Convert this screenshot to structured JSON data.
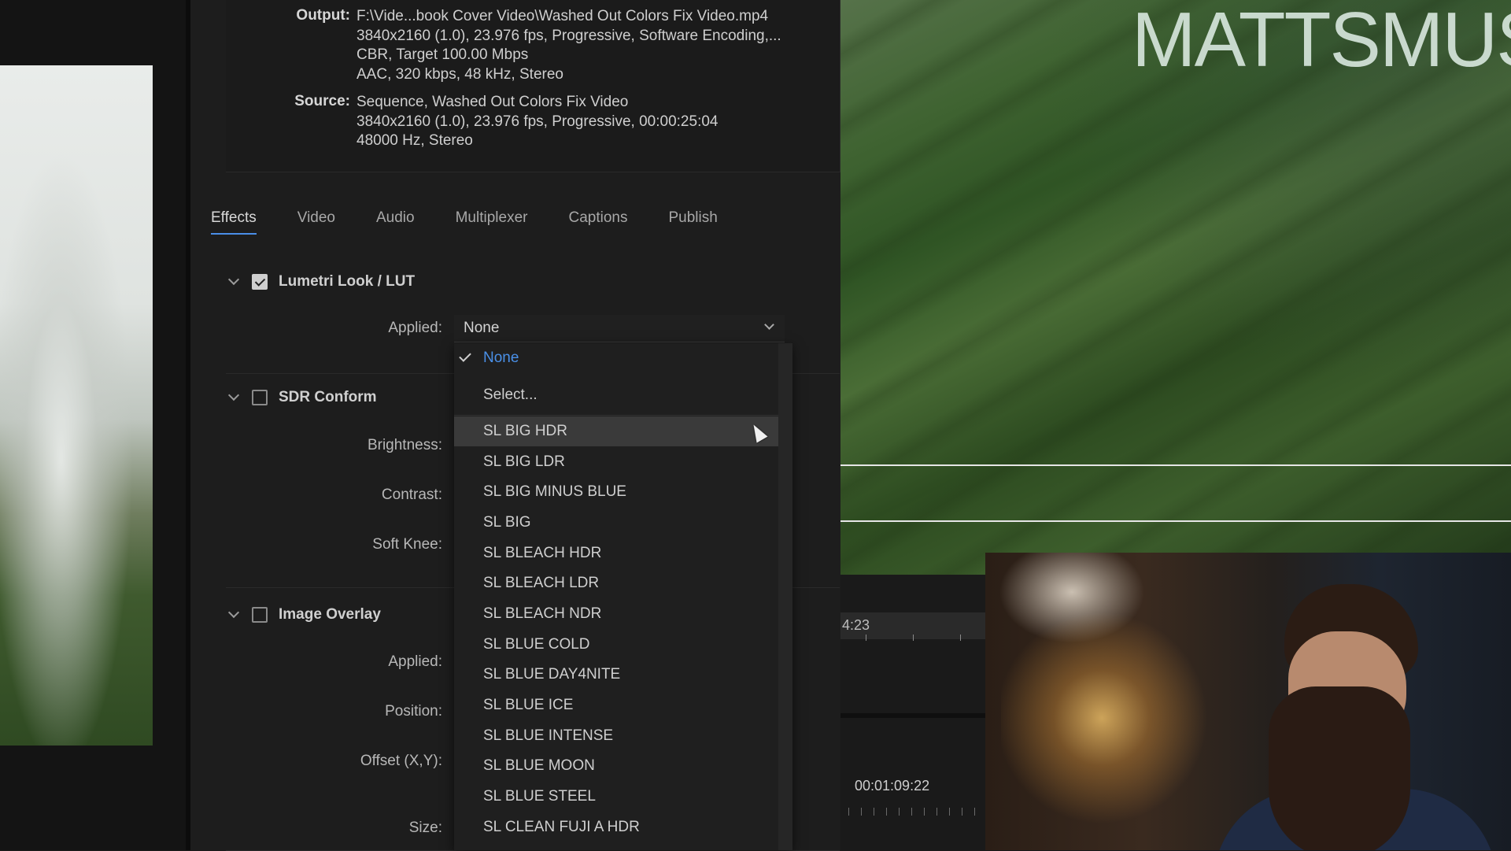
{
  "summary": {
    "output_label": "Output:",
    "output_lines": [
      "F:\\Vide...book Cover Video\\Washed Out Colors Fix Video.mp4",
      "3840x2160 (1.0), 23.976 fps, Progressive, Software Encoding,...",
      "CBR, Target 100.00 Mbps",
      "AAC, 320 kbps, 48 kHz, Stereo"
    ],
    "source_label": "Source:",
    "source_lines": [
      "Sequence, Washed Out Colors Fix Video",
      "3840x2160 (1.0), 23.976 fps, Progressive, 00:00:25:04",
      "48000 Hz, Stereo"
    ]
  },
  "tabs": [
    "Effects",
    "Video",
    "Audio",
    "Multiplexer",
    "Captions",
    "Publish"
  ],
  "active_tab": "Effects",
  "sections": {
    "lumetri": {
      "title": "Lumetri Look / LUT",
      "checked": true,
      "applied_label": "Applied:",
      "applied_value": "None"
    },
    "sdr": {
      "title": "SDR Conform",
      "checked": false,
      "fields": [
        "Brightness:",
        "Contrast:",
        "Soft Knee:"
      ]
    },
    "overlay": {
      "title": "Image Overlay",
      "checked": false,
      "fields": [
        "Applied:",
        "Position:",
        "Offset (X,Y):",
        "Size:"
      ]
    }
  },
  "dropdown": {
    "selected": "None",
    "hovered": "SL BIG HDR",
    "items": [
      "None",
      "Select...",
      "SL BIG HDR",
      "SL BIG LDR",
      "SL BIG MINUS BLUE",
      "SL BIG",
      "SL BLEACH HDR",
      "SL BLEACH LDR",
      "SL BLEACH NDR",
      "SL BLUE COLD",
      "SL BLUE DAY4NITE",
      "SL BLUE ICE",
      "SL BLUE INTENSE",
      "SL BLUE MOON",
      "SL BLUE STEEL",
      "SL CLEAN FUJI A HDR"
    ]
  },
  "program_monitor": {
    "brand_text": "MATTSMUS"
  },
  "timeline": {
    "time_top": "4:23",
    "time_bottom": "00:01:09:22"
  },
  "colors": {
    "accent": "#4a90e8",
    "panel_bg": "#1d1d1d",
    "hover_bg": "#3a3a3a"
  }
}
